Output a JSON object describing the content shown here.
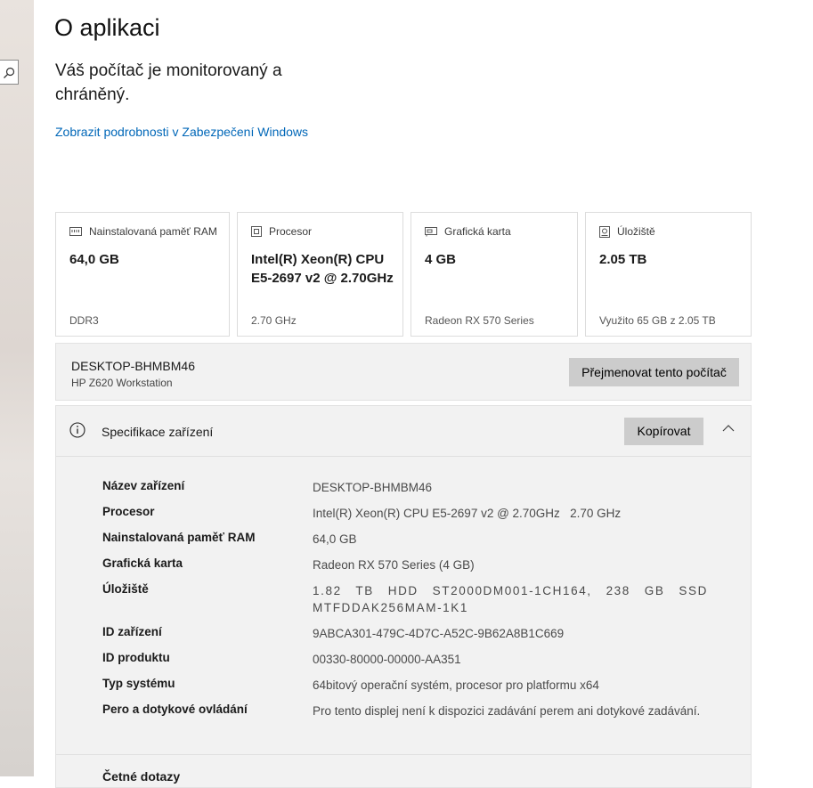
{
  "page": {
    "title": "O aplikaci",
    "status": "Váš počítač je monitorovaný a chráněný.",
    "security_link": "Zobrazit podrobnosti v Zabezpečení Windows"
  },
  "cards": [
    {
      "icon": "memory-icon",
      "label": "Nainstalovaná paměť RAM",
      "value": "64,0 GB",
      "sub": "DDR3"
    },
    {
      "icon": "processor-icon",
      "label": "Procesor",
      "value": "Intel(R) Xeon(R) CPU E5-2697 v2 @ 2.70GHz",
      "sub": "2.70 GHz"
    },
    {
      "icon": "graphics-card-icon",
      "label": "Grafická karta",
      "value": "4 GB",
      "sub": "Radeon RX 570 Series"
    },
    {
      "icon": "storage-icon",
      "label": "Úložiště",
      "value": "2.05 TB",
      "sub": "Využito 65 GB z 2.05 TB"
    }
  ],
  "device": {
    "name": "DESKTOP-BHMBM46",
    "model": "HP Z620 Workstation",
    "rename_label": "Přejmenovat tento počítač"
  },
  "specs": {
    "title": "Specifikace zařízení",
    "copy_label": "Kopírovat",
    "rows": [
      {
        "key": "Název zařízení",
        "value": "DESKTOP-BHMBM46"
      },
      {
        "key": "Procesor",
        "value": "Intel(R) Xeon(R) CPU E5-2697 v2 @ 2.70GHz   2.70 GHz"
      },
      {
        "key": "Nainstalovaná paměť RAM",
        "value": "64,0 GB"
      },
      {
        "key": "Grafická karta",
        "value": "Radeon RX 570 Series (4 GB)"
      },
      {
        "key": "Úložiště",
        "value": "1.82 TB HDD ST2000DM001-1CH164, 238 GB SSD MTFDDAK256MAM-1K1"
      },
      {
        "key": "ID zařízení",
        "value": "9ABCA301-479C-4D7C-A52C-9B62A8B1C669"
      },
      {
        "key": "ID produktu",
        "value": "00330-80000-00000-AA351"
      },
      {
        "key": "Typ systému",
        "value": "64bitový operační systém, procesor pro platformu x64"
      },
      {
        "key": "Pero a dotykové ovládání",
        "value": "Pro tento displej není k dispozici zadávání perem ani dotykové zadávání."
      }
    ],
    "next_section_title": "Četné dotazy"
  },
  "colors": {
    "link": "#0067b8",
    "button": "#cccccc",
    "panel": "#f2f2f2"
  }
}
